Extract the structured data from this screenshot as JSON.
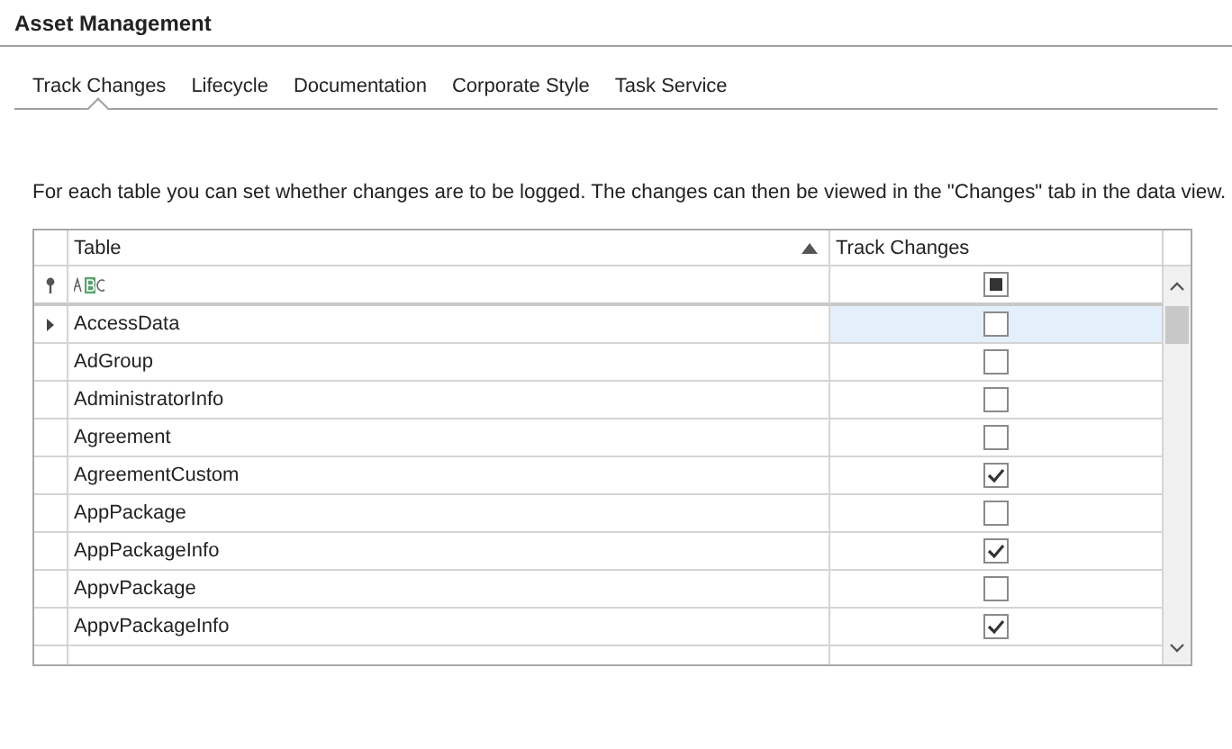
{
  "window": {
    "title": "Asset Management"
  },
  "tabs": [
    {
      "label": "Track Changes",
      "selected": true
    },
    {
      "label": "Lifecycle",
      "selected": false
    },
    {
      "label": "Documentation",
      "selected": false
    },
    {
      "label": "Corporate Style",
      "selected": false
    },
    {
      "label": "Task Service",
      "selected": false
    }
  ],
  "description": "For each table you can set whether changes are to be logged. The changes can then be viewed in the \"Changes\" tab in the data view.",
  "grid": {
    "columns": [
      {
        "label": "Table",
        "sorted_ascending": true
      },
      {
        "label": "Track Changes",
        "sorted_ascending": false
      }
    ],
    "filter_row": {
      "track_changes_indeterminate": true
    },
    "rows": [
      {
        "name": "AccessData",
        "track_changes": false,
        "selected": true
      },
      {
        "name": "AdGroup",
        "track_changes": false,
        "selected": false
      },
      {
        "name": "AdministratorInfo",
        "track_changes": false,
        "selected": false
      },
      {
        "name": "Agreement",
        "track_changes": false,
        "selected": false
      },
      {
        "name": "AgreementCustom",
        "track_changes": true,
        "selected": false
      },
      {
        "name": "AppPackage",
        "track_changes": false,
        "selected": false
      },
      {
        "name": "AppPackageInfo",
        "track_changes": true,
        "selected": false
      },
      {
        "name": "AppvPackage",
        "track_changes": false,
        "selected": false
      },
      {
        "name": "AppvPackageInfo",
        "track_changes": true,
        "selected": false
      }
    ]
  }
}
